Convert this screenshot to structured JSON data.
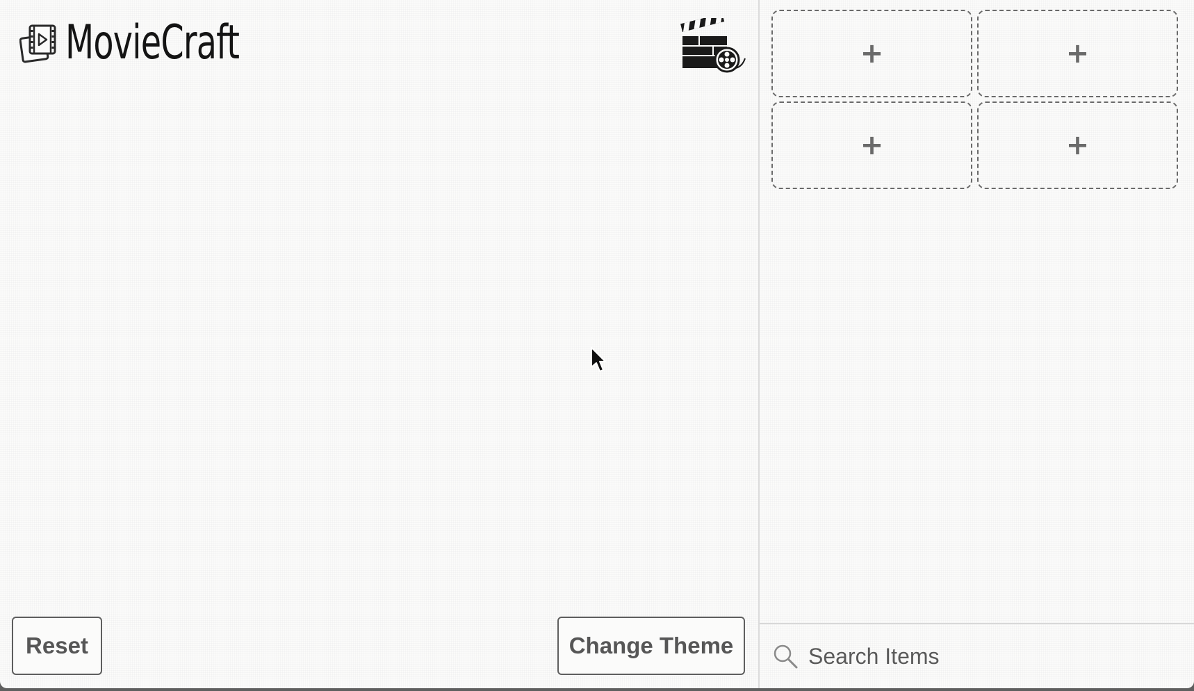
{
  "app": {
    "title": "MovieCraft",
    "logo_icon": "film-cards-icon",
    "header_icon": "clapperboard-film-reel-icon"
  },
  "actions": {
    "reset_label": "Reset",
    "change_theme_label": "Change Theme"
  },
  "slots": [
    {
      "label": "+",
      "icon": "plus-icon"
    },
    {
      "label": "+",
      "icon": "plus-icon"
    },
    {
      "label": "+",
      "icon": "plus-icon"
    },
    {
      "label": "+",
      "icon": "plus-icon"
    }
  ],
  "search": {
    "placeholder": "Search Items",
    "value": "",
    "icon": "search-icon"
  },
  "colors": {
    "background": "#fbfbfa",
    "text": "#141414",
    "border": "#5e5e5e",
    "slot_border": "#6a6a6a"
  }
}
